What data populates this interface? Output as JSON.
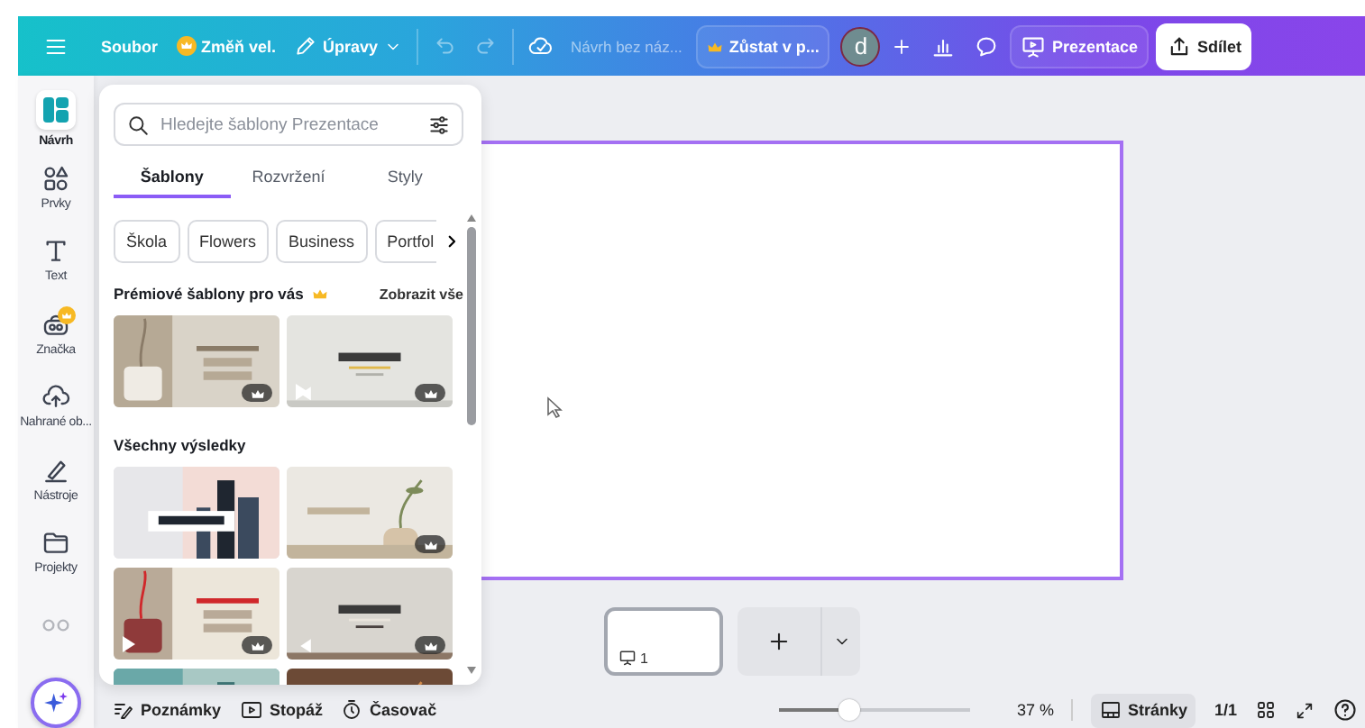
{
  "topbar": {
    "menu": [
      {
        "kind": "text",
        "label": "Soubor"
      },
      {
        "kind": "premium",
        "label": "Změň vel."
      },
      {
        "kind": "dropdown",
        "label": "Úpravy"
      }
    ],
    "undo": {
      "disabled": true
    },
    "redo": {
      "disabled": true
    },
    "title": "Návrh bez náz...",
    "upgrade": "Zůstat v p...",
    "avatar": "d",
    "present": "Prezentace",
    "share": "Sdílet"
  },
  "rail": [
    {
      "kind": "design",
      "label": "Návrh",
      "selected": true,
      "premium": false
    },
    {
      "kind": "elements",
      "label": "Prvky",
      "selected": false,
      "premium": false
    },
    {
      "kind": "text",
      "label": "Text",
      "selected": false,
      "premium": false
    },
    {
      "kind": "brand",
      "label": "Značka",
      "selected": false,
      "premium": true
    },
    {
      "kind": "uploads",
      "label": "Nahrané ob...",
      "selected": false,
      "premium": false
    },
    {
      "kind": "tools",
      "label": "Nástroje",
      "selected": false,
      "premium": false
    },
    {
      "kind": "projects",
      "label": "Projekty",
      "selected": false,
      "premium": false
    },
    {
      "kind": "apps",
      "selected": false,
      "premium": false
    }
  ],
  "panel": {
    "search": {
      "placeholder": "Hledejte šablony Prezentace"
    },
    "tabs": [
      {
        "label": "Šablony",
        "selected": true
      },
      {
        "label": "Rozvržení",
        "selected": false
      },
      {
        "label": "Styly",
        "selected": false
      }
    ],
    "chips": [
      "Škola",
      "Flowers",
      "Business",
      "Portfol"
    ],
    "premium_section": {
      "heading": "Prémiové šablony pro vás",
      "link": "Zobrazit vše",
      "templates": [
        {
          "kind": "picture",
          "premium": true,
          "video": false
        },
        {
          "kind": "picture",
          "premium": true,
          "video": true
        }
      ]
    },
    "results_section": {
      "heading": "Všechny výsledky",
      "templates": [
        {
          "kind": "picture",
          "premium": false,
          "video": false
        },
        {
          "kind": "picture",
          "premium": true,
          "video": false
        },
        {
          "kind": "picture",
          "premium": true,
          "video": true
        },
        {
          "kind": "picture",
          "premium": true,
          "video": false
        },
        {
          "kind": "picture"
        },
        {
          "kind": "picture"
        }
      ]
    }
  },
  "pages": [
    {
      "number": "1",
      "selected": true
    }
  ],
  "footer": {
    "tools": [
      {
        "kind": "notes",
        "label": "Poznámky"
      },
      {
        "kind": "duration",
        "label": "Stopáž"
      },
      {
        "kind": "timer",
        "label": "Časovač"
      }
    ],
    "zoom": {
      "level": 0.37,
      "reading": "37 %"
    },
    "pages_button": "Stránky",
    "page_count": "1/1"
  }
}
